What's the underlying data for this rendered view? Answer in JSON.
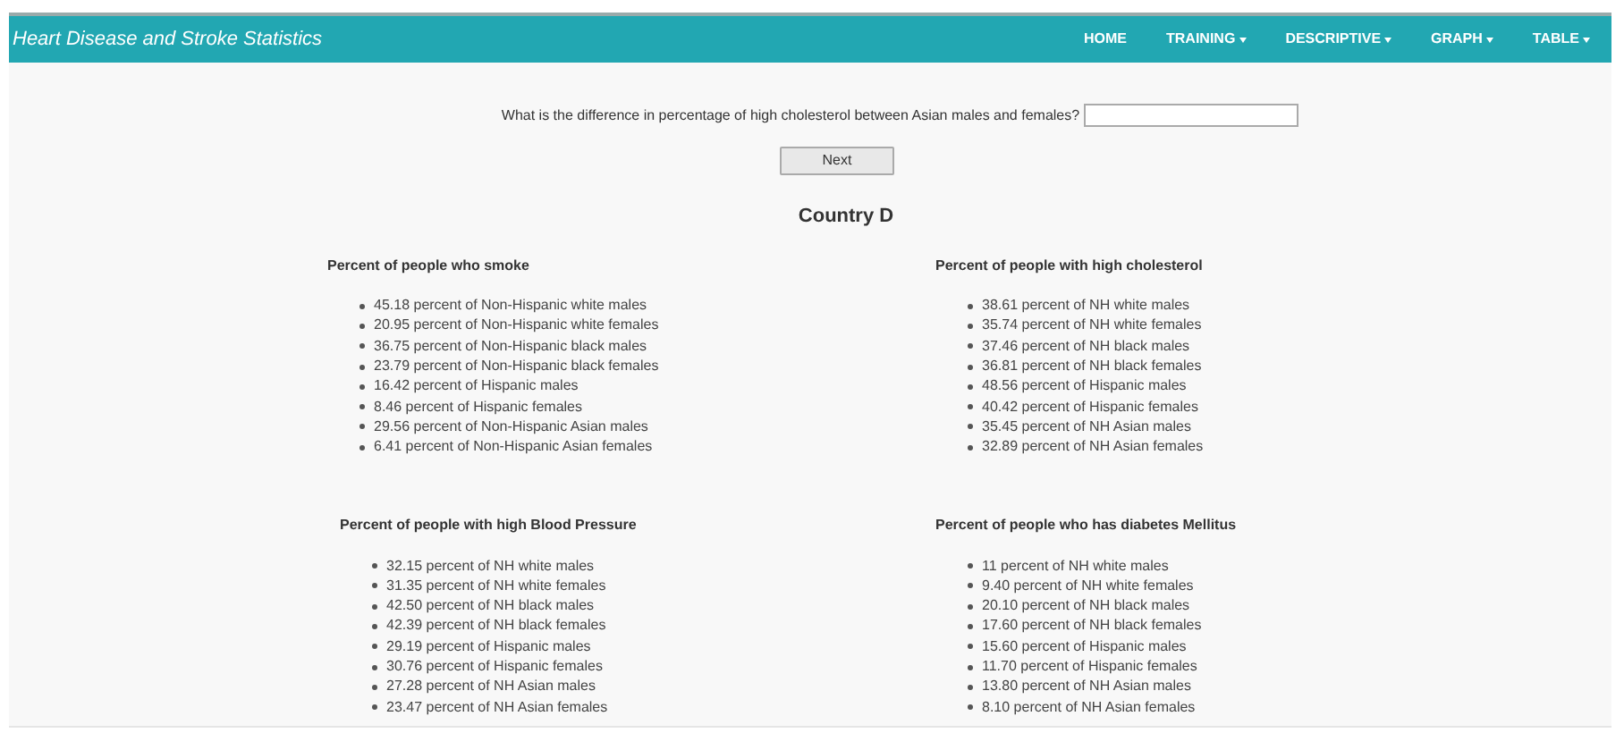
{
  "navbar": {
    "title": "Heart Disease and Stroke Statistics",
    "items": [
      {
        "label": "HOME",
        "has_menu": false
      },
      {
        "label": "TRAINING",
        "has_menu": true
      },
      {
        "label": "DESCRIPTIVE",
        "has_menu": true
      },
      {
        "label": "GRAPH",
        "has_menu": true
      },
      {
        "label": "TABLE",
        "has_menu": true
      }
    ]
  },
  "question": {
    "text": "What is the difference in percentage of high cholesterol between Asian males and females?"
  },
  "next_button": "Next",
  "country": "Country D",
  "sections": [
    {
      "heading": "Percent of people who smoke",
      "items": [
        "45.18 percent of Non-Hispanic white males",
        "20.95 percent of Non-Hispanic white females",
        "36.75 percent of Non-Hispanic black males",
        "23.79 percent of Non-Hispanic black females",
        "16.42 percent of Hispanic males",
        "8.46 percent of Hispanic females",
        "29.56 percent of Non-Hispanic Asian males",
        "6.41 percent of Non-Hispanic Asian females"
      ]
    },
    {
      "heading": "Percent of people with high cholesterol",
      "items": [
        "38.61 percent of NH white males",
        "35.74 percent of NH white females",
        "37.46 percent of NH black males",
        "36.81 percent of NH black females",
        "48.56 percent of Hispanic males",
        "40.42 percent of Hispanic females",
        "35.45 percent of NH Asian males",
        "32.89 percent of NH Asian females"
      ]
    },
    {
      "heading": "Percent of people with high Blood Pressure",
      "items": [
        "32.15 percent of NH white males",
        "31.35 percent of NH white females",
        "42.50 percent of NH black males",
        "42.39 percent of NH black females",
        "29.19 percent of Hispanic males",
        "30.76 percent of Hispanic females",
        "27.28 percent of NH Asian males",
        "23.47 percent of NH Asian females"
      ]
    },
    {
      "heading": "Percent of people who has diabetes Mellitus",
      "items": [
        "11 percent of NH white males",
        "9.40 percent of NH white females",
        "20.10 percent of NH black males",
        "17.60 percent of NH black females",
        "15.60 percent of Hispanic males",
        "11.70 percent of Hispanic females",
        "13.80 percent of NH Asian males",
        "8.10 percent of NH Asian females"
      ]
    }
  ]
}
